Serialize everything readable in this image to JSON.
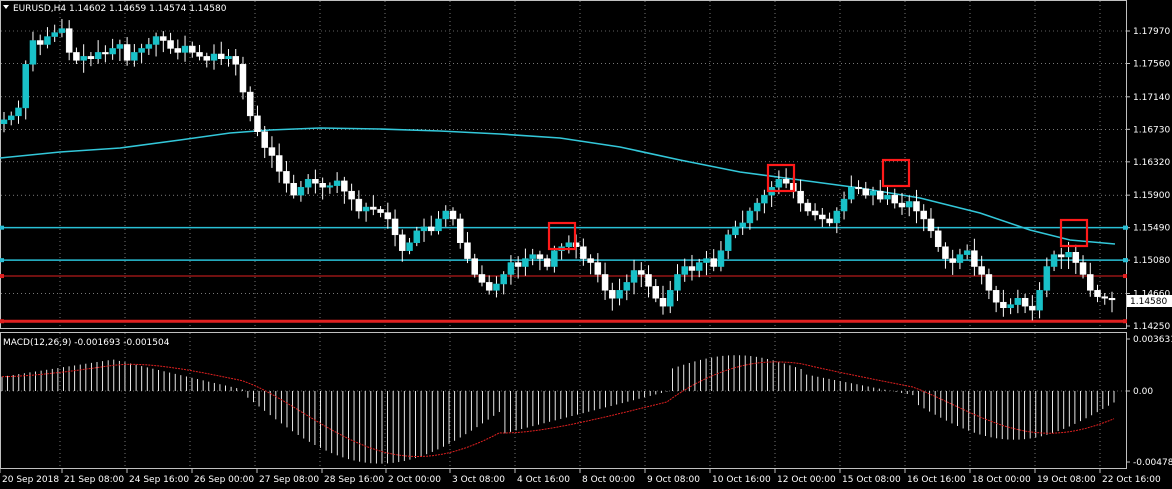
{
  "header": {
    "symbol_line": "EURUSD,H4  1.14602 1.14659 1.14574 1.14580"
  },
  "macd": {
    "label": "MACD(12,26,9) -0.001693 -0.001504"
  },
  "price_axis": {
    "ticks": [
      "1.17970",
      "1.17560",
      "1.17140",
      "1.16730",
      "1.16320",
      "1.15900",
      "1.15490",
      "1.15080",
      "1.14660",
      "1.14250"
    ],
    "current_price": "1.14580"
  },
  "macd_axis": {
    "ticks": [
      "0.003631",
      "0.00",
      "-0.004784"
    ]
  },
  "time_axis": {
    "ticks": [
      "20 Sep 2018",
      "21 Sep 08:00",
      "24 Sep 16:00",
      "26 Sep 00:00",
      "27 Sep 08:00",
      "28 Sep 16:00",
      "2 Oct 00:00",
      "3 Oct 08:00",
      "4 Oct 16:00",
      "8 Oct 00:00",
      "9 Oct 08:00",
      "10 Oct 16:00",
      "12 Oct 00:00",
      "15 Oct 08:00",
      "16 Oct 16:00",
      "18 Oct 00:00",
      "19 Oct 08:00",
      "22 Oct 16:00"
    ]
  },
  "colors": {
    "background": "#000000",
    "candle_up": "#ffffff",
    "candle_down": "#ffffff",
    "up_body": "#19c1c8",
    "moving_average": "#33c7d9",
    "support_cyan": "#29c0d6",
    "support_red": "#e02020",
    "highlight_box": "#ff1a1a",
    "signal_line": "#e02020",
    "grid": "#c0c0c0"
  },
  "levels": {
    "cyan_upper": 1.1549,
    "cyan_lower": 1.1508,
    "red_thin": 1.1488,
    "red_thick": 1.1431
  },
  "highlight_marks": [
    "box-1",
    "box-2",
    "box-3",
    "box-4"
  ]
}
